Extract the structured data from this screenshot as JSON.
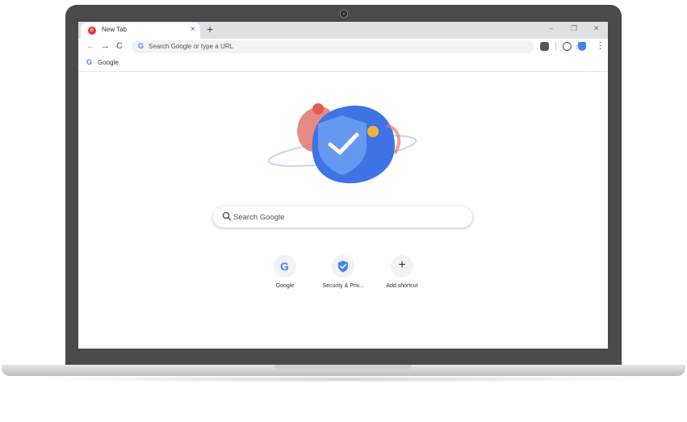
{
  "browser": {
    "tab": {
      "title": "New Tab",
      "close_icon": "×"
    },
    "new_tab_icon": "+",
    "window_controls": {
      "minimize": "–",
      "restore": "❐",
      "close": "✕"
    },
    "nav": {
      "back": "←",
      "forward": "→",
      "reload": "C"
    },
    "omnibox": {
      "g_mark": "G",
      "placeholder": "Search Google or type a URL"
    },
    "star_icon": "☆",
    "menu_icon": "⋮",
    "bookmarks": [
      {
        "icon": "G",
        "label": "Google"
      }
    ]
  },
  "ntp": {
    "search": {
      "placeholder": "Search Google"
    },
    "shortcuts": [
      {
        "label": "Google",
        "icon": "google-g-icon",
        "glyph": "G"
      },
      {
        "label": "Security & Priv...",
        "icon": "shield-check-icon"
      },
      {
        "label": "Add shortcut",
        "icon": "plus-icon",
        "glyph": "+"
      }
    ]
  },
  "colors": {
    "accent": "#4285f4",
    "tabstrip": "#dee1e6",
    "omnibox_bg": "#f1f3f4",
    "laptop_frame": "#4a4a4a"
  }
}
